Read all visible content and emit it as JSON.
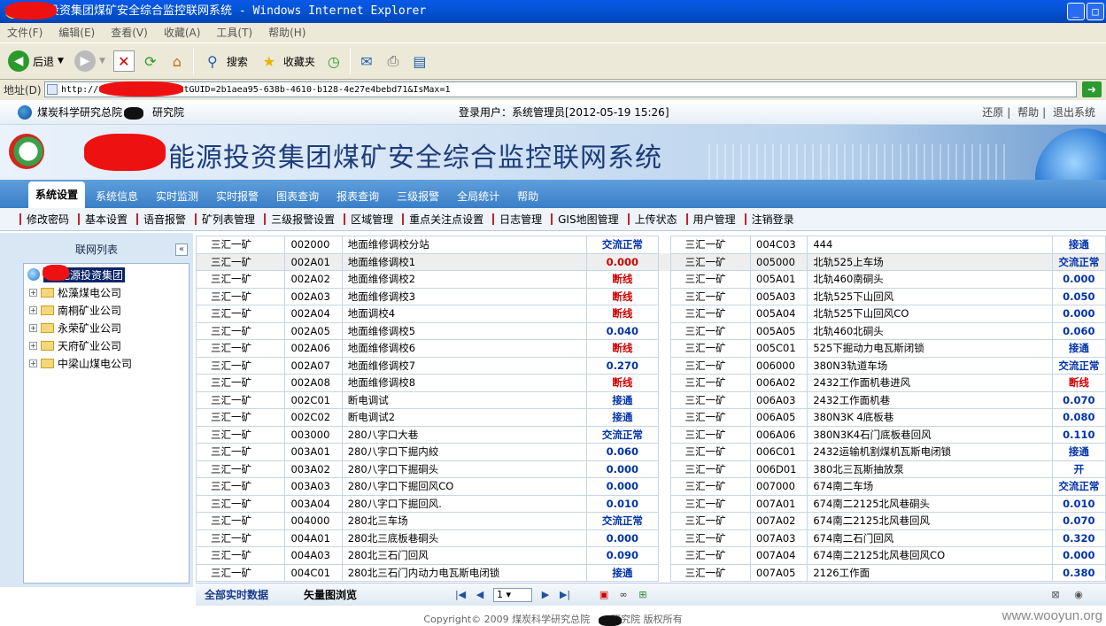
{
  "window": {
    "title": "能源投资集团煤矿安全综合监控联网系统 - Windows Internet Explorer",
    "buttons": [
      "_",
      "□"
    ]
  },
  "menu": [
    "文件(F)",
    "编辑(E)",
    "查看(V)",
    "收藏(A)",
    "工具(T)",
    "帮助(H)"
  ],
  "toolbar": {
    "back": "后退",
    "search": "搜索",
    "favorites": "收藏夹"
  },
  "address": {
    "label": "地址(D)",
    "url": "http://                main.aspx?ClientGUID=2b1aea95-638b-4610-b128-4e27e4bebd71&IsMax=1"
  },
  "top": {
    "org": "煤炭科学研究总院",
    "org_suffix": "研究院",
    "user": "登录用户：系统管理员[2012-05-19 15:26]",
    "links": [
      "还原",
      "帮助",
      "退出系统"
    ]
  },
  "banner": {
    "title": "能源投资集团煤矿安全综合监控联网系统"
  },
  "nav": [
    "系统设置",
    "系统信息",
    "实时监测",
    "实时报警",
    "图表查询",
    "报表查询",
    "三级报警",
    "全局统计",
    "帮助"
  ],
  "subnav": [
    "修改密码",
    "基本设置",
    "语音报警",
    "矿列表管理",
    "三级报警设置",
    "区域管理",
    "重点关注点设置",
    "日志管理",
    "GIS地图管理",
    "上传状态",
    "用户管理",
    "注销登录"
  ],
  "tree": {
    "header": "联网列表",
    "collapse": "«",
    "root": "能源投资集团",
    "children": [
      "松藻煤电公司",
      "南桐矿业公司",
      "永荣矿业公司",
      "天府矿业公司",
      "中梁山煤电公司"
    ]
  },
  "rows": [
    {
      "m1": "三汇一矿",
      "c1": "002000",
      "n1": "地面维修调校分站",
      "v1": "交流正常",
      "k1": "blue",
      "m2": "三汇一矿",
      "c2": "004C03",
      "n2": "444",
      "v2": "接通",
      "k2": "blue"
    },
    {
      "m1": "三汇一矿",
      "c1": "002A01",
      "n1": "地面维修调校1",
      "v1": "0.000",
      "k1": "red",
      "m2": "三汇一矿",
      "c2": "005000",
      "n2": "北轨525上车场",
      "v2": "交流正常",
      "k2": "blue"
    },
    {
      "m1": "三汇一矿",
      "c1": "002A02",
      "n1": "地面维修调校2",
      "v1": "断线",
      "k1": "red",
      "m2": "三汇一矿",
      "c2": "005A01",
      "n2": "北轨460南硐头",
      "v2": "0.000",
      "k2": "blue"
    },
    {
      "m1": "三汇一矿",
      "c1": "002A03",
      "n1": "地面维修调校3",
      "v1": "断线",
      "k1": "red",
      "m2": "三汇一矿",
      "c2": "005A03",
      "n2": "北轨525下山回风",
      "v2": "0.050",
      "k2": "blue"
    },
    {
      "m1": "三汇一矿",
      "c1": "002A04",
      "n1": "地面调校4",
      "v1": "断线",
      "k1": "red",
      "m2": "三汇一矿",
      "c2": "005A04",
      "n2": "北轨525下山回风CO",
      "v2": "0.000",
      "k2": "blue"
    },
    {
      "m1": "三汇一矿",
      "c1": "002A05",
      "n1": "地面维修调校5",
      "v1": "0.040",
      "k1": "blue",
      "m2": "三汇一矿",
      "c2": "005A05",
      "n2": "北轨460北硐头",
      "v2": "0.060",
      "k2": "blue"
    },
    {
      "m1": "三汇一矿",
      "c1": "002A06",
      "n1": "地面维修调校6",
      "v1": "断线",
      "k1": "red",
      "m2": "三汇一矿",
      "c2": "005C01",
      "n2": "525下掘动力电瓦斯闭锁",
      "v2": "接通",
      "k2": "blue"
    },
    {
      "m1": "三汇一矿",
      "c1": "002A07",
      "n1": "地面维修调校7",
      "v1": "0.270",
      "k1": "blue",
      "m2": "三汇一矿",
      "c2": "006000",
      "n2": "380N3轨道车场",
      "v2": "交流正常",
      "k2": "blue"
    },
    {
      "m1": "三汇一矿",
      "c1": "002A08",
      "n1": "地面维修调校8",
      "v1": "断线",
      "k1": "red",
      "m2": "三汇一矿",
      "c2": "006A02",
      "n2": "2432工作面机巷进风",
      "v2": "断线",
      "k2": "red"
    },
    {
      "m1": "三汇一矿",
      "c1": "002C01",
      "n1": "断电调试",
      "v1": "接通",
      "k1": "blue",
      "m2": "三汇一矿",
      "c2": "006A03",
      "n2": "2432工作面机巷",
      "v2": "0.070",
      "k2": "blue"
    },
    {
      "m1": "三汇一矿",
      "c1": "002C02",
      "n1": "断电调试2",
      "v1": "接通",
      "k1": "blue",
      "m2": "三汇一矿",
      "c2": "006A05",
      "n2": "380N3K 4底板巷",
      "v2": "0.080",
      "k2": "blue"
    },
    {
      "m1": "三汇一矿",
      "c1": "003000",
      "n1": "280八字口大巷",
      "v1": "交流正常",
      "k1": "blue",
      "m2": "三汇一矿",
      "c2": "006A06",
      "n2": "380N3K4石门底板巷回风",
      "v2": "0.110",
      "k2": "blue"
    },
    {
      "m1": "三汇一矿",
      "c1": "003A01",
      "n1": "280八字口下掘内絞",
      "v1": "0.060",
      "k1": "blue",
      "m2": "三汇一矿",
      "c2": "006C01",
      "n2": "2432运输机割煤机瓦斯电闭锁",
      "v2": "接通",
      "k2": "blue"
    },
    {
      "m1": "三汇一矿",
      "c1": "003A02",
      "n1": "280八字口下掘硐头",
      "v1": "0.000",
      "k1": "blue",
      "m2": "三汇一矿",
      "c2": "006D01",
      "n2": "380北三瓦斯抽放泵",
      "v2": "开",
      "k2": "blue"
    },
    {
      "m1": "三汇一矿",
      "c1": "003A03",
      "n1": "280八字口下掘回风CO",
      "v1": "0.000",
      "k1": "blue",
      "m2": "三汇一矿",
      "c2": "007000",
      "n2": "674南二车场",
      "v2": "交流正常",
      "k2": "blue"
    },
    {
      "m1": "三汇一矿",
      "c1": "003A04",
      "n1": "280八字口下掘回风.",
      "v1": "0.010",
      "k1": "blue",
      "m2": "三汇一矿",
      "c2": "007A01",
      "n2": "674南二2125北风巷硐头",
      "v2": "0.010",
      "k2": "blue"
    },
    {
      "m1": "三汇一矿",
      "c1": "004000",
      "n1": "280北三车场",
      "v1": "交流正常",
      "k1": "blue",
      "m2": "三汇一矿",
      "c2": "007A02",
      "n2": "674南二2125北风巷回风",
      "v2": "0.070",
      "k2": "blue"
    },
    {
      "m1": "三汇一矿",
      "c1": "004A01",
      "n1": "280北三底板巷硐头",
      "v1": "0.000",
      "k1": "blue",
      "m2": "三汇一矿",
      "c2": "007A03",
      "n2": "674南二石门回风",
      "v2": "0.320",
      "k2": "blue"
    },
    {
      "m1": "三汇一矿",
      "c1": "004A03",
      "n1": "280北三石门回风",
      "v1": "0.090",
      "k1": "blue",
      "m2": "三汇一矿",
      "c2": "007A04",
      "n2": "674南二2125北风巷回风CO",
      "v2": "0.000",
      "k2": "blue"
    },
    {
      "m1": "三汇一矿",
      "c1": "004C01",
      "n1": "280北三石门内动力电瓦斯电闭锁",
      "v1": "接通",
      "k1": "blue",
      "m2": "三汇一矿",
      "c2": "007A05",
      "n2": "2126工作面",
      "v2": "0.380",
      "k2": "blue"
    }
  ],
  "bottom": {
    "tab_all": "全部实时数据",
    "tab_vector": "矢量图浏览",
    "page": "1"
  },
  "footer": "Copyright© 2009 煤炭科学研究总院",
  "footer_suffix": "研究院 版权所有",
  "watermark": "www.wooyun.org"
}
